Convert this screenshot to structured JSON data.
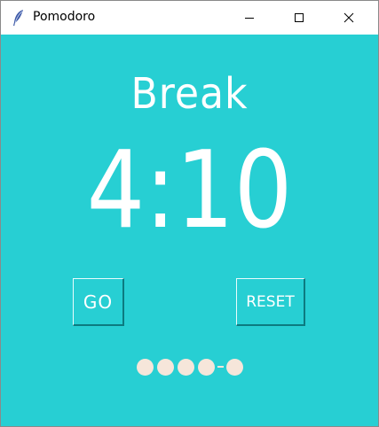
{
  "window": {
    "title": "Pomodoro",
    "app_icon": "feather-icon",
    "controls": [
      "minimize-icon",
      "maximize-icon",
      "close-icon"
    ]
  },
  "timer": {
    "mode": "Break",
    "time": "4:10"
  },
  "buttons": {
    "go_label": "GO",
    "reset_label": "RESET"
  },
  "progress": {
    "completed": 4,
    "remaining": 1,
    "indicator_order": [
      "dot",
      "dot",
      "dot",
      "dot",
      "separator",
      "dot"
    ]
  },
  "colors": {
    "background": "#27cfd3",
    "text": "#ffffff",
    "dot": "#f6e6da"
  }
}
